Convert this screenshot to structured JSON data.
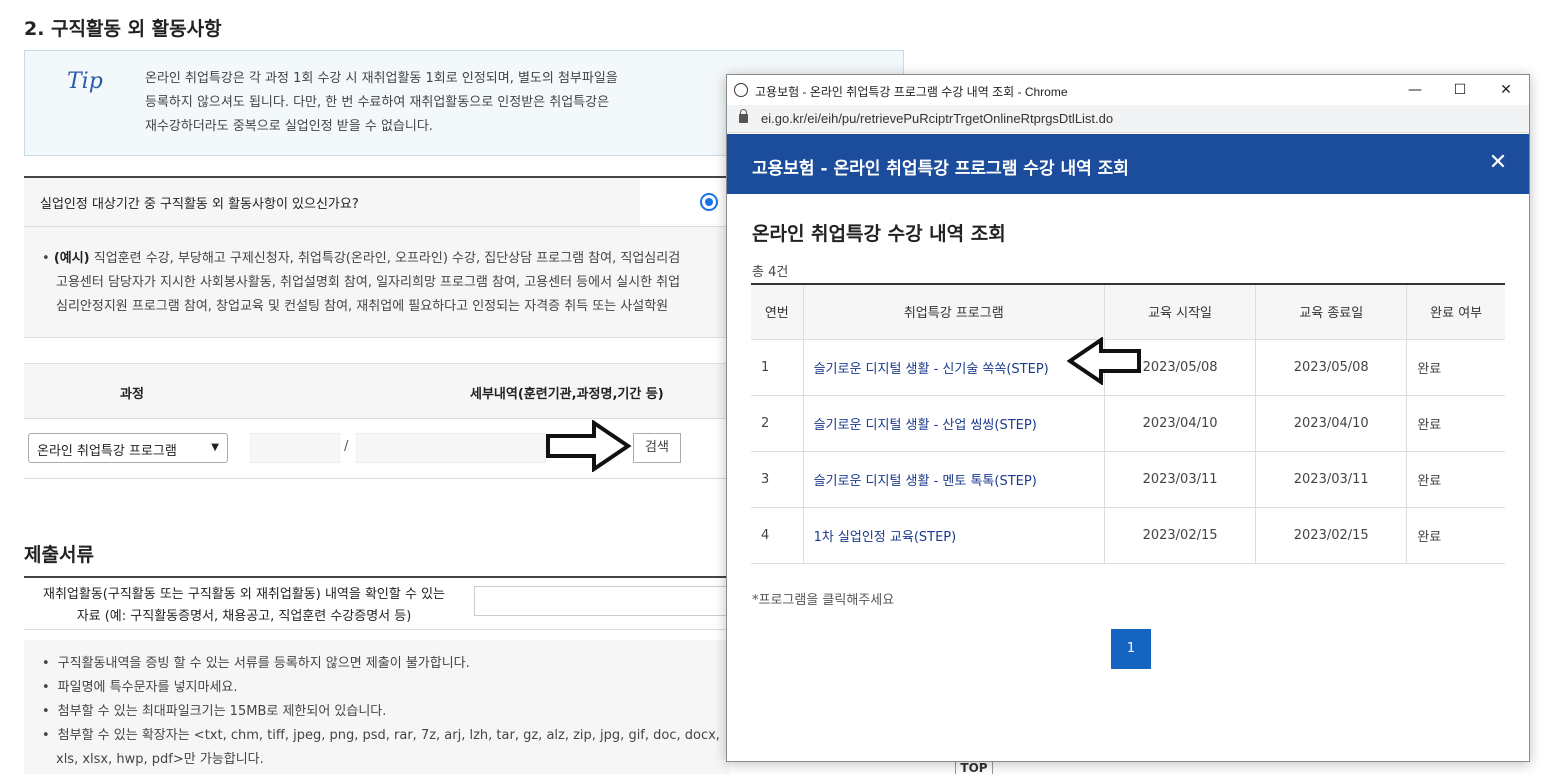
{
  "page": {
    "section_title": "2. 구직활동 외 활동사항",
    "tip": {
      "label": "Tip",
      "lines": [
        "온라인 취업특강은 각 과정 1회 수강 시 재취업활동 1회로 인정되며, 별도의 첨부파일을",
        "등록하지 않으셔도 됩니다. 다만, 한 번 수료하여 재취업활동으로 인정받은 취업특강은",
        "재수강하더라도 중복으로 실업인정 받을 수 없습니다."
      ]
    },
    "question": "실업인정 대상기간 중 구직활동 외 활동사항이 있으신가요?",
    "example": {
      "prefix": "(예시)",
      "lines": [
        " 직업훈련 수강, 부당해고 구제신청자, 취업특강(온라인, 오프라인) 수강, 집단상담 프로그램 참여, 직업심리검",
        "고용센터 담당자가 지시한 사회봉사활동, 취업설명회 참여, 일자리희망 프로그램 참여, 고용센터 등에서 실시한 취업",
        "심리안정지원 프로그램 참여, 창업교육 및 컨설팅 참여, 재취업에 필요하다고 인정되는 자격증 취득 또는 사설학원"
      ]
    },
    "table": {
      "col_course": "과정",
      "col_detail": "세부내역(훈련기관,과정명,기간 등)",
      "course_value": "온라인 취업특강 프로그램",
      "separator": "/",
      "search_label": "검색"
    },
    "submit": {
      "title": "제출서류",
      "label_line1": "재취업활동(구직활동 또는 구직활동 외 재취업활동) 내역을 확인할 수 있는",
      "label_line2": "자료 (예: 구직활동증명서, 채용공고, 직업훈련 수강증명서 등)",
      "notices": [
        "구직활동내역을 증빙 할 수 있는 서류를 등록하지 않으면 제출이 불가합니다.",
        "파일명에 특수문자를 넣지마세요.",
        "첨부할 수 있는 최대파일크기는 15MB로 제한되어 있습니다.",
        "첨부할 수 있는 확장자는 <txt, chm, tiff, jpeg, png, psd, rar, 7z, arj, lzh, tar, gz, alz, zip, jpg, gif, doc, docx,",
        "xls, xlsx, hwp, pdf>만 가능합니다."
      ]
    },
    "top_button": "TOP"
  },
  "popup": {
    "window_title": "고용보험 - 온라인 취업특강 프로그램 수강 내역 조회 - Chrome",
    "url": "ei.go.kr/ei/eih/pu/retrievePuRciptrTrgetOnlineRtprgsDtlList.do",
    "header_title": "고용보험 - 온라인 취업특강 프로그램 수강 내역 조회",
    "heading": "온라인 취업특강 수강 내역 조회",
    "count": "총 4건",
    "columns": [
      "연번",
      "취업특강 프로그램",
      "교육 시작일",
      "교육 종료일",
      "완료 여부"
    ],
    "rows": [
      {
        "no": "1",
        "program": "슬기로운 디지털 생활 - 신기술 쏙쏙(STEP)",
        "start": "2023/05/08",
        "end": "2023/05/08",
        "done": "완료"
      },
      {
        "no": "2",
        "program": "슬기로운 디지털 생활 - 산업 씽씽(STEP)",
        "start": "2023/04/10",
        "end": "2023/04/10",
        "done": "완료"
      },
      {
        "no": "3",
        "program": "슬기로운 디지털 생활 - 멘토 톡톡(STEP)",
        "start": "2023/03/11",
        "end": "2023/03/11",
        "done": "완료"
      },
      {
        "no": "4",
        "program": "1차 실업인정 교육(STEP)",
        "start": "2023/02/15",
        "end": "2023/02/15",
        "done": "완료"
      }
    ],
    "note": "*프로그램을 클릭해주세요",
    "page_number": "1",
    "header_color": "#1b4d9c",
    "page_button_color": "#1565c0"
  },
  "icons": {
    "tip": "tip-label",
    "radio": "radio-selected",
    "arrow_right": "arrow-right-outline",
    "arrow_left": "arrow-left-outline",
    "globe": "globe-icon",
    "lock": "lock-icon",
    "close": "close-icon"
  }
}
